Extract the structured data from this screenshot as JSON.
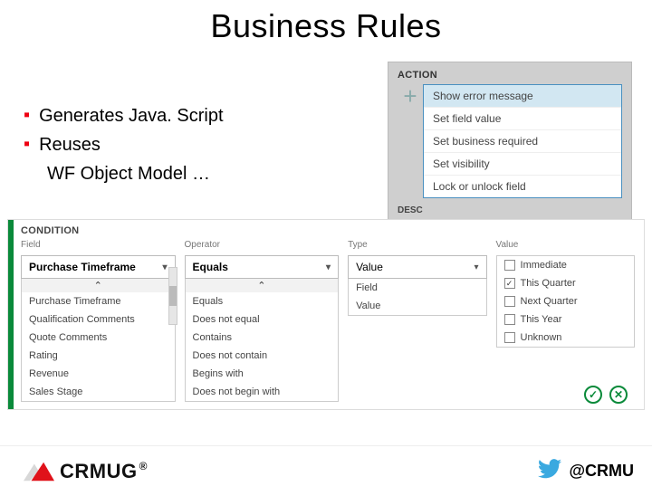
{
  "title": "Business Rules",
  "bullets": {
    "b1": "Generates Java. Script",
    "b2": "Reuses",
    "b3": "WF Object Model …"
  },
  "action_panel": {
    "header": "ACTION",
    "desc_label": "DESC",
    "desc_value": "--",
    "items": [
      "Show error message",
      "Set field value",
      "Set business required",
      "Set visibility",
      "Lock or unlock field"
    ],
    "selected_index": 0
  },
  "condition_panel": {
    "header": "CONDITION",
    "field": {
      "label": "Field",
      "selected": "Purchase Timeframe",
      "options": [
        "Purchase Timeframe",
        "Qualification Comments",
        "Quote Comments",
        "Rating",
        "Revenue",
        "Sales Stage"
      ]
    },
    "operator": {
      "label": "Operator",
      "selected": "Equals",
      "options": [
        "Equals",
        "Does not equal",
        "Contains",
        "Does not contain",
        "Begins with",
        "Does not begin with"
      ]
    },
    "type": {
      "label": "Type",
      "selected": "Value",
      "options": [
        "Field",
        "Value"
      ]
    },
    "value": {
      "label": "Value",
      "options": [
        {
          "label": "Immediate",
          "checked": false
        },
        {
          "label": "This Quarter",
          "checked": true
        },
        {
          "label": "Next Quarter",
          "checked": false
        },
        {
          "label": "This Year",
          "checked": false
        },
        {
          "label": "Unknown",
          "checked": false
        }
      ]
    }
  },
  "footer": {
    "logo_text": "CRMUG",
    "handle": "@CRMU"
  }
}
